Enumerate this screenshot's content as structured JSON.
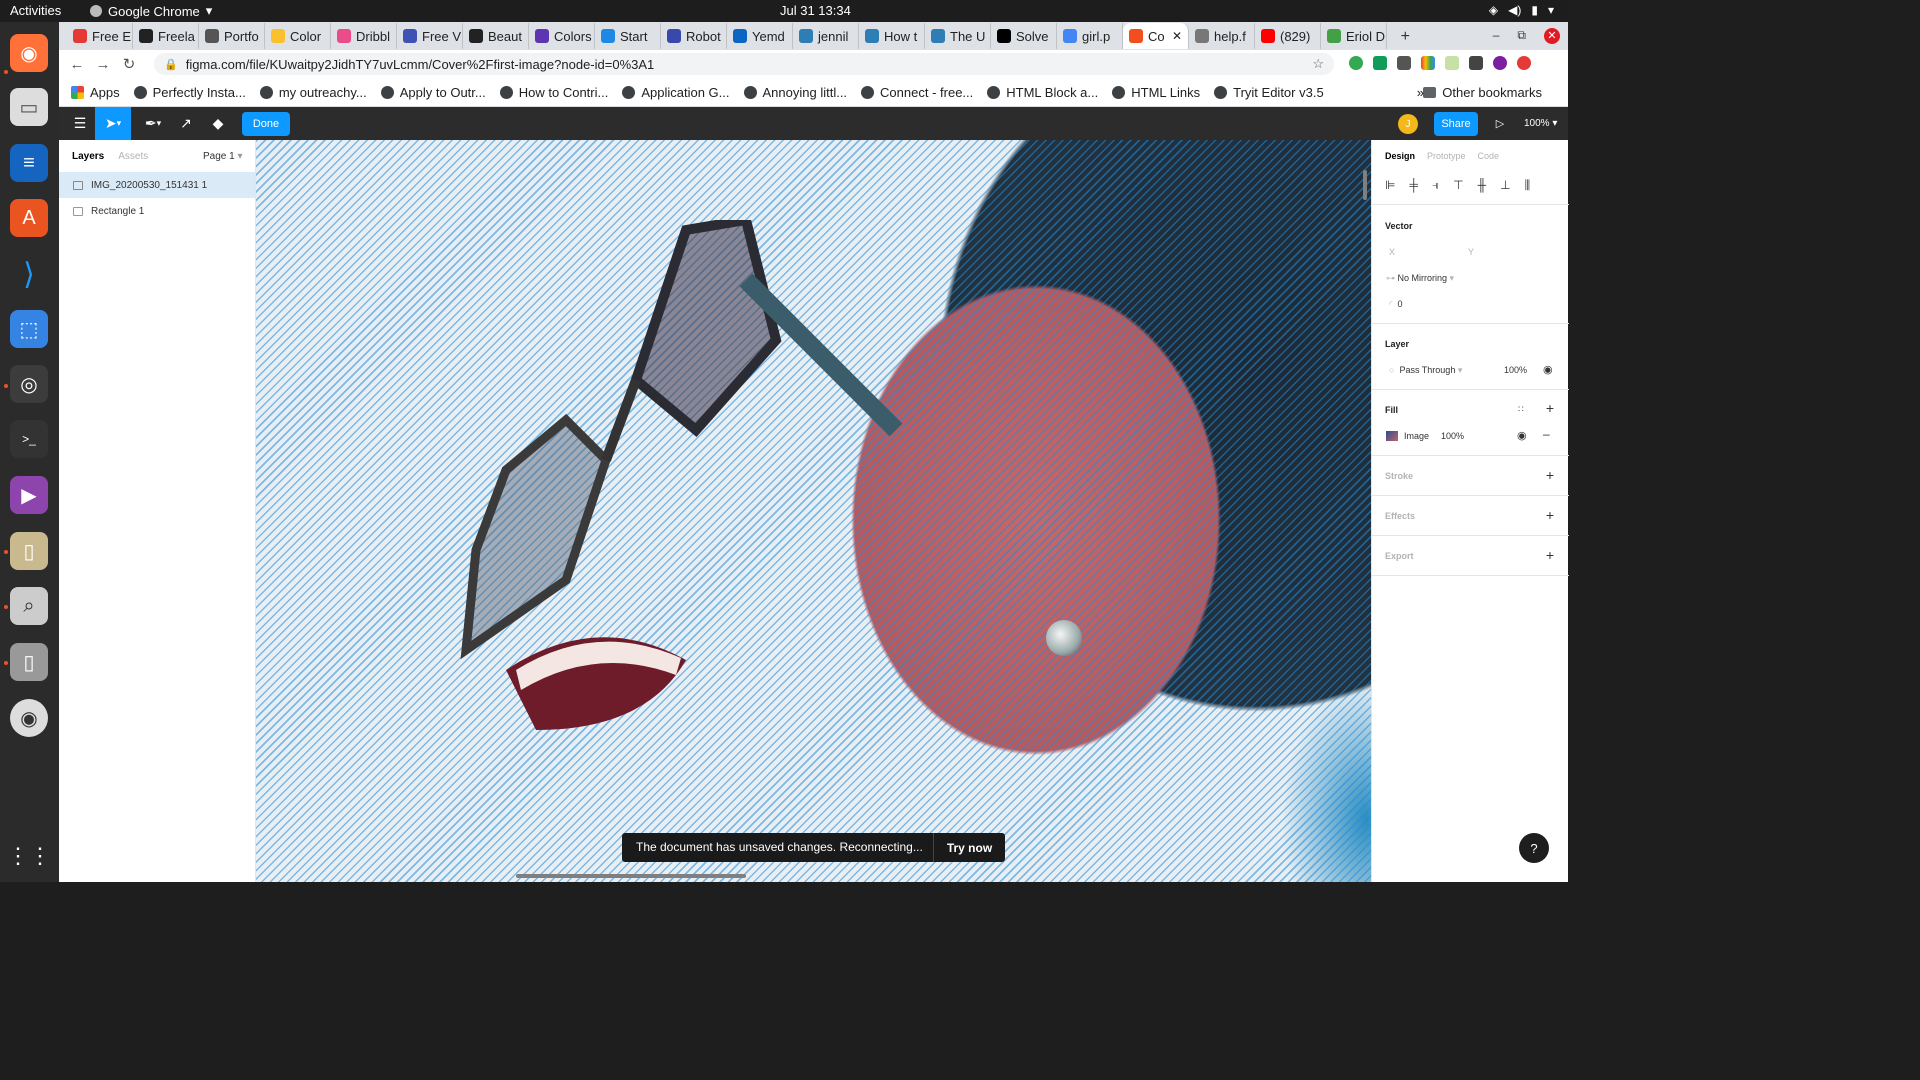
{
  "topbar": {
    "activities": "Activities",
    "app_name": "Google Chrome",
    "clock": "Jul 31  13:34"
  },
  "tabs": [
    {
      "label": "Free E",
      "color": "#e53935"
    },
    {
      "label": "Freela",
      "color": "#222222"
    },
    {
      "label": "Portfo",
      "color": "#555555"
    },
    {
      "label": "Color",
      "color": "#fbc02d"
    },
    {
      "label": "Dribbl",
      "color": "#ea4c89"
    },
    {
      "label": "Free V",
      "color": "#3f51b5"
    },
    {
      "label": "Beaut",
      "color": "#222222"
    },
    {
      "label": "Colors",
      "color": "#5e35b1"
    },
    {
      "label": "Start",
      "color": "#1e88e5"
    },
    {
      "label": "Robot",
      "color": "#3949ab"
    },
    {
      "label": "Yemd",
      "color": "#0a66c2"
    },
    {
      "label": "jennil",
      "color": "#2e7db5"
    },
    {
      "label": "How t",
      "color": "#2e7db5"
    },
    {
      "label": "The U",
      "color": "#2e7db5"
    },
    {
      "label": "Solve",
      "color": "#000000"
    },
    {
      "label": "girl.p",
      "color": "#4285f4"
    },
    {
      "label": "Co",
      "color": "#f24e1e",
      "active": true
    },
    {
      "label": "help.f",
      "color": "#777777"
    },
    {
      "label": "(829)",
      "color": "#ff0000"
    },
    {
      "label": "Eriol D",
      "color": "#43a047"
    }
  ],
  "address": {
    "url": "figma.com/file/KUwaitpy2JidhTY7uvLcmm/Cover%2Ffirst-image?node-id=0%3A1"
  },
  "bookmarks": [
    "Apps",
    "Perfectly Insta...",
    "my outreachy...",
    "Apply to Outr...",
    "How to Contri...",
    "Application G...",
    "Annoying littl...",
    "Connect - free...",
    "HTML Block a...",
    "HTML Links",
    "Tryit Editor v3.5"
  ],
  "bookmarks_other": "Other bookmarks",
  "figma": {
    "done": "Done",
    "share": "Share",
    "avatar_initial": "J",
    "zoom": "100%",
    "layers_tab": "Layers",
    "assets_tab": "Assets",
    "page": "Page 1",
    "layers": [
      "IMG_20200530_151431 1",
      "Rectangle 1"
    ],
    "design_tab": "Design",
    "prototype_tab": "Prototype",
    "code_tab": "Code",
    "vector": "Vector",
    "x_label": "X",
    "y_label": "Y",
    "mirroring": "No Mirroring",
    "radius": "0",
    "layer": "Layer",
    "blend": "Pass Through",
    "layer_opacity": "100%",
    "fill": "Fill",
    "fill_type": "Image",
    "fill_opacity": "100%",
    "stroke": "Stroke",
    "effects": "Effects",
    "export": "Export"
  },
  "toast": {
    "message": "The document has unsaved changes. Reconnecting...",
    "action": "Try now"
  },
  "help": "?"
}
